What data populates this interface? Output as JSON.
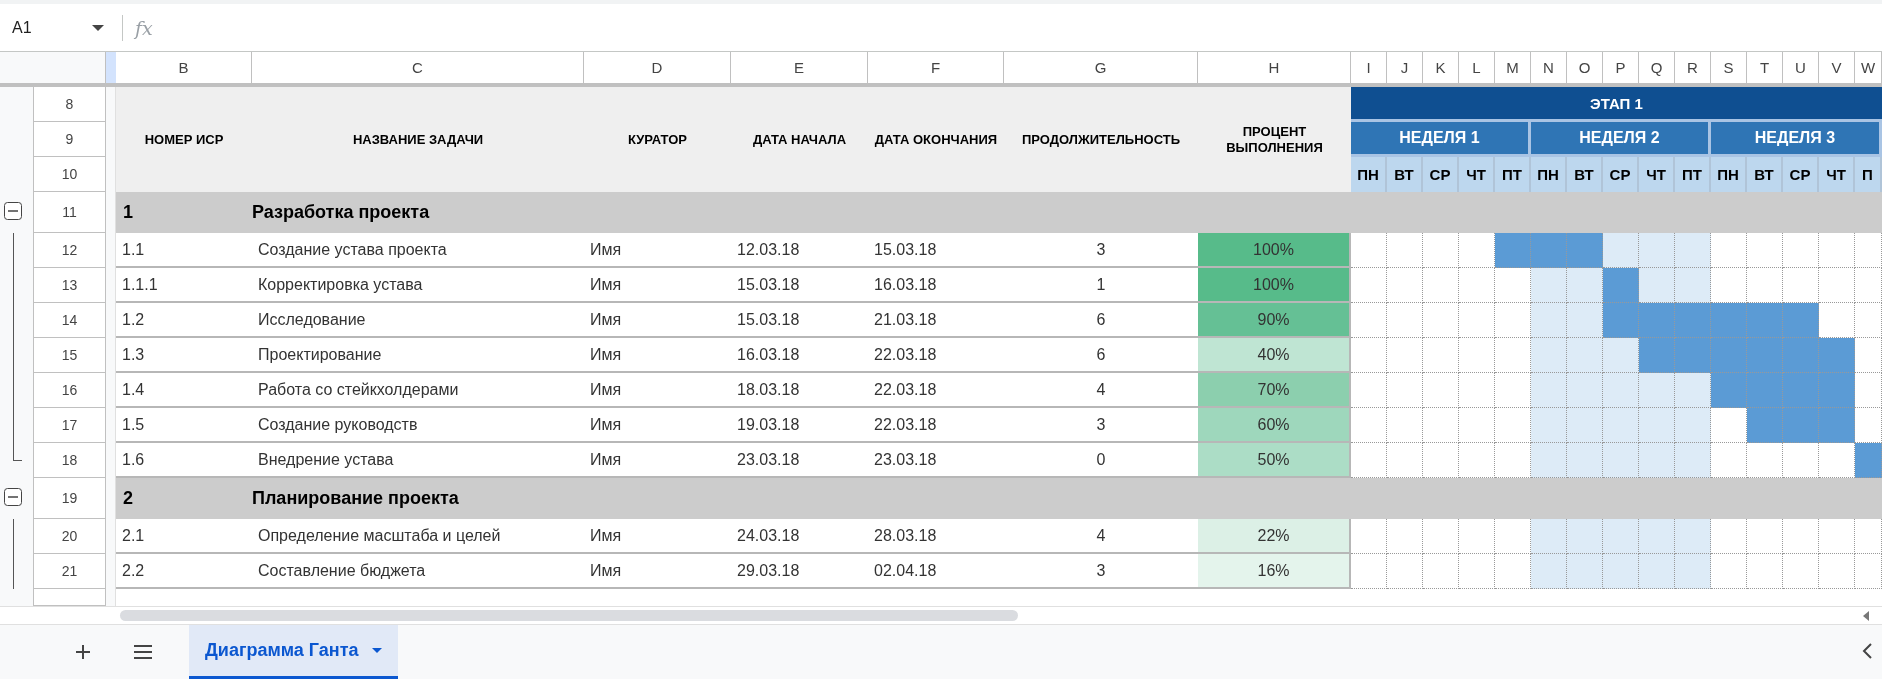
{
  "formula_bar": {
    "name_box": "A1",
    "formula_icon": "fx"
  },
  "column_letters": [
    "B",
    "C",
    "D",
    "E",
    "F",
    "G",
    "H",
    "I",
    "J",
    "K",
    "L",
    "M",
    "N",
    "O",
    "P",
    "Q",
    "R",
    "S",
    "T",
    "U",
    "V",
    "W"
  ],
  "row_numbers": [
    "8",
    "9",
    "10",
    "11",
    "12",
    "13",
    "14",
    "15",
    "16",
    "17",
    "18",
    "19",
    "20",
    "21"
  ],
  "columns": [
    "НОМЕР ИСР",
    "НАЗВАНИЕ ЗАДАЧИ",
    "КУРАТОР",
    "ДАТА НАЧАЛА",
    "ДАТА ОКОНЧАНИЯ",
    "ПРОДОЛЖИТЕЛЬНОСТЬ",
    "ПРОЦЕНТ ВЫПОЛНЕНИЯ"
  ],
  "gantt_header": {
    "phase": "ЭТАП 1",
    "weeks": [
      {
        "label": "НЕДЕЛЯ 1",
        "highlighted": false,
        "days": [
          "ПН",
          "ВТ",
          "СР",
          "ЧТ",
          "ПТ"
        ]
      },
      {
        "label": "НЕДЕЛЯ 2",
        "highlighted": true,
        "days": [
          "ПН",
          "ВТ",
          "СР",
          "ЧТ",
          "ПТ"
        ]
      },
      {
        "label": "НЕДЕЛЯ 3",
        "highlighted": false,
        "days": [
          "ПН",
          "ВТ",
          "СР",
          "ЧТ",
          "П"
        ]
      }
    ]
  },
  "groups": [
    {
      "number": "1",
      "title": "Разработка проекта",
      "expanded": true,
      "tasks": [
        {
          "id": "1.1",
          "name": "Создание устава проекта",
          "owner": "Имя",
          "start": "12.03.18",
          "end": "15.03.18",
          "duration": "3",
          "percent": "100%",
          "color": "#57bb8a",
          "timeline": [
            false,
            false,
            false,
            false,
            true,
            true,
            true,
            false,
            false,
            false,
            false,
            false,
            false,
            false,
            false
          ]
        },
        {
          "id": "1.1.1",
          "name": "Корректировка устава",
          "owner": "Имя",
          "start": "15.03.18",
          "end": "16.03.18",
          "duration": "1",
          "percent": "100%",
          "color": "#57bb8a",
          "timeline": [
            false,
            false,
            false,
            false,
            false,
            false,
            false,
            true,
            false,
            false,
            false,
            false,
            false,
            false,
            false
          ]
        },
        {
          "id": "1.2",
          "name": "Исследование",
          "owner": "Имя",
          "start": "15.03.18",
          "end": "21.03.18",
          "duration": "6",
          "percent": "90%",
          "color": "#65c095",
          "timeline": [
            false,
            false,
            false,
            false,
            false,
            false,
            false,
            true,
            true,
            true,
            true,
            true,
            true,
            false,
            false
          ]
        },
        {
          "id": "1.3",
          "name": "Проектирование",
          "owner": "Имя",
          "start": "16.03.18",
          "end": "22.03.18",
          "duration": "6",
          "percent": "40%",
          "color": "#bfe5d3",
          "timeline": [
            false,
            false,
            false,
            false,
            false,
            false,
            false,
            false,
            true,
            true,
            true,
            true,
            true,
            true,
            false
          ]
        },
        {
          "id": "1.4",
          "name": "Работа со стейкхолдерами",
          "owner": "Имя",
          "start": "18.03.18",
          "end": "22.03.18",
          "duration": "4",
          "percent": "70%",
          "color": "#8ccfae",
          "timeline": [
            false,
            false,
            false,
            false,
            false,
            false,
            false,
            false,
            false,
            false,
            true,
            true,
            true,
            true,
            false
          ]
        },
        {
          "id": "1.5",
          "name": "Создание руководств",
          "owner": "Имя",
          "start": "19.03.18",
          "end": "22.03.18",
          "duration": "3",
          "percent": "60%",
          "color": "#9ed7bc",
          "timeline": [
            false,
            false,
            false,
            false,
            false,
            false,
            false,
            false,
            false,
            false,
            false,
            true,
            true,
            true,
            false
          ]
        },
        {
          "id": "1.6",
          "name": "Внедрение устава",
          "owner": "Имя",
          "start": "23.03.18",
          "end": "23.03.18",
          "duration": "0",
          "percent": "50%",
          "color": "#acddc6",
          "timeline": [
            false,
            false,
            false,
            false,
            false,
            false,
            false,
            false,
            false,
            false,
            false,
            false,
            false,
            false,
            true
          ]
        }
      ]
    },
    {
      "number": "2",
      "title": "Планирование проекта",
      "expanded": true,
      "tasks": [
        {
          "id": "2.1",
          "name": "Определение масштаба и целей",
          "owner": "Имя",
          "start": "24.03.18",
          "end": "28.03.18",
          "duration": "4",
          "percent": "22%",
          "color": "#dcf0e6",
          "timeline": [
            false,
            false,
            false,
            false,
            false,
            false,
            false,
            false,
            false,
            false,
            false,
            false,
            false,
            false,
            false
          ]
        },
        {
          "id": "2.2",
          "name": "Составление бюджета",
          "owner": "Имя",
          "start": "29.03.18",
          "end": "02.04.18",
          "duration": "3",
          "percent": "16%",
          "color": "#e4f4ec",
          "timeline": [
            false,
            false,
            false,
            false,
            false,
            false,
            false,
            false,
            false,
            false,
            false,
            false,
            false,
            false,
            false
          ]
        }
      ]
    }
  ],
  "sheet_tabs": [
    {
      "label": "Диаграмма Ганта",
      "selected": true
    }
  ]
}
